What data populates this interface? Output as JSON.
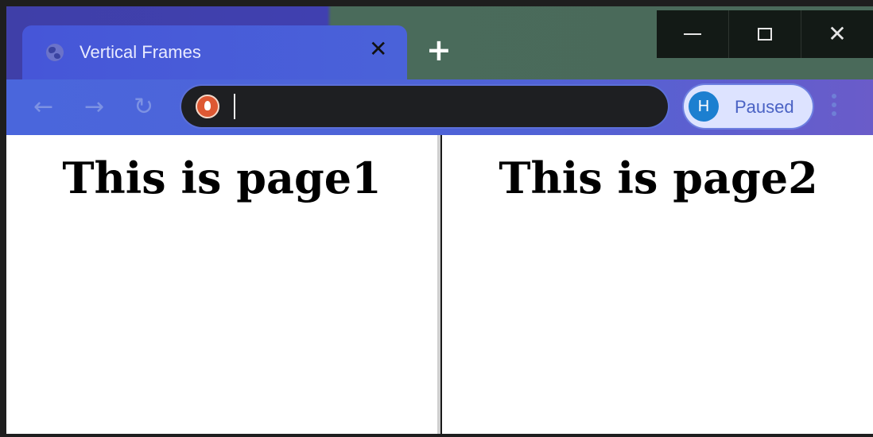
{
  "window": {
    "controls": {
      "minimize_icon": "minimize-icon",
      "maximize_icon": "maximize-icon",
      "close_icon": "close-icon"
    }
  },
  "tab": {
    "title": "Vertical Frames",
    "favicon": "globe-icon",
    "close_glyph": "✕",
    "new_tab_glyph": "+"
  },
  "toolbar": {
    "back_glyph": "←",
    "forward_glyph": "→",
    "reload_glyph": "↻",
    "address_value": "",
    "search_engine_icon": "duckduckgo-icon",
    "profile_initial": "H",
    "profile_status": "Paused"
  },
  "frames": [
    {
      "heading": "This is page1"
    },
    {
      "heading": "This is page2"
    }
  ],
  "colors": {
    "tab_active": "#4656d8",
    "toolbar": "#4a66dc",
    "omnibox": "#1e1f22",
    "avatar": "#1c7fd0"
  }
}
